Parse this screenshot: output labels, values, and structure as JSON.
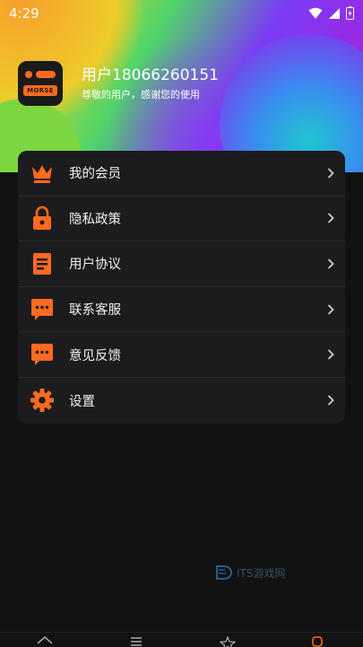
{
  "status_bar": {
    "time": "4:29"
  },
  "profile": {
    "logo_text": "MORSE",
    "username": "用户18066260151",
    "subtitle": "尊敬的用户，感谢您的使用"
  },
  "menu": {
    "items": [
      {
        "label": "我的会员",
        "icon": "crown-icon"
      },
      {
        "label": "隐私政策",
        "icon": "lock-icon"
      },
      {
        "label": "用户协议",
        "icon": "document-icon"
      },
      {
        "label": "联系客服",
        "icon": "chat-icon"
      },
      {
        "label": "意见反馈",
        "icon": "feedback-icon"
      },
      {
        "label": "设置",
        "icon": "gear-icon"
      }
    ]
  },
  "watermark": "ITS游戏网",
  "colors": {
    "accent": "#ff6a1f",
    "card": "#1c1c1e",
    "background": "#121212"
  }
}
